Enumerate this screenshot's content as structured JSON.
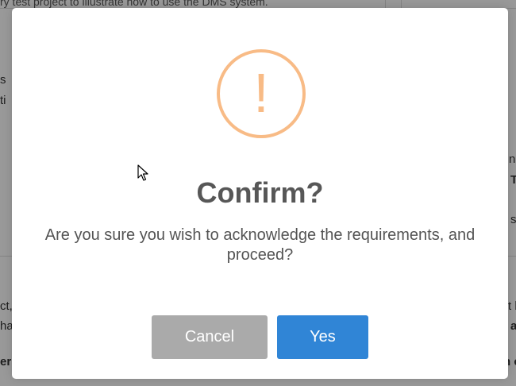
{
  "background": {
    "top_line": "ry test project to illustrate how to use the DMS system.",
    "left_fragments": [
      "s",
      "ti",
      "ct,",
      "ha",
      "er"
    ],
    "right_fragments": [
      "ni",
      "T",
      "s",
      "t b",
      "a",
      "n c"
    ]
  },
  "dialog": {
    "icon": "warning-exclamation-icon",
    "icon_glyph": "!",
    "title": "Confirm?",
    "text": "Are you sure you wish to acknowledge the requirements, and proceed?",
    "buttons": {
      "cancel": "Cancel",
      "confirm": "Yes"
    }
  },
  "colors": {
    "warning": "#f8bb86",
    "confirm_button": "#3085d6",
    "cancel_button": "#aaaaaa",
    "title": "#575757",
    "text": "#545454"
  }
}
